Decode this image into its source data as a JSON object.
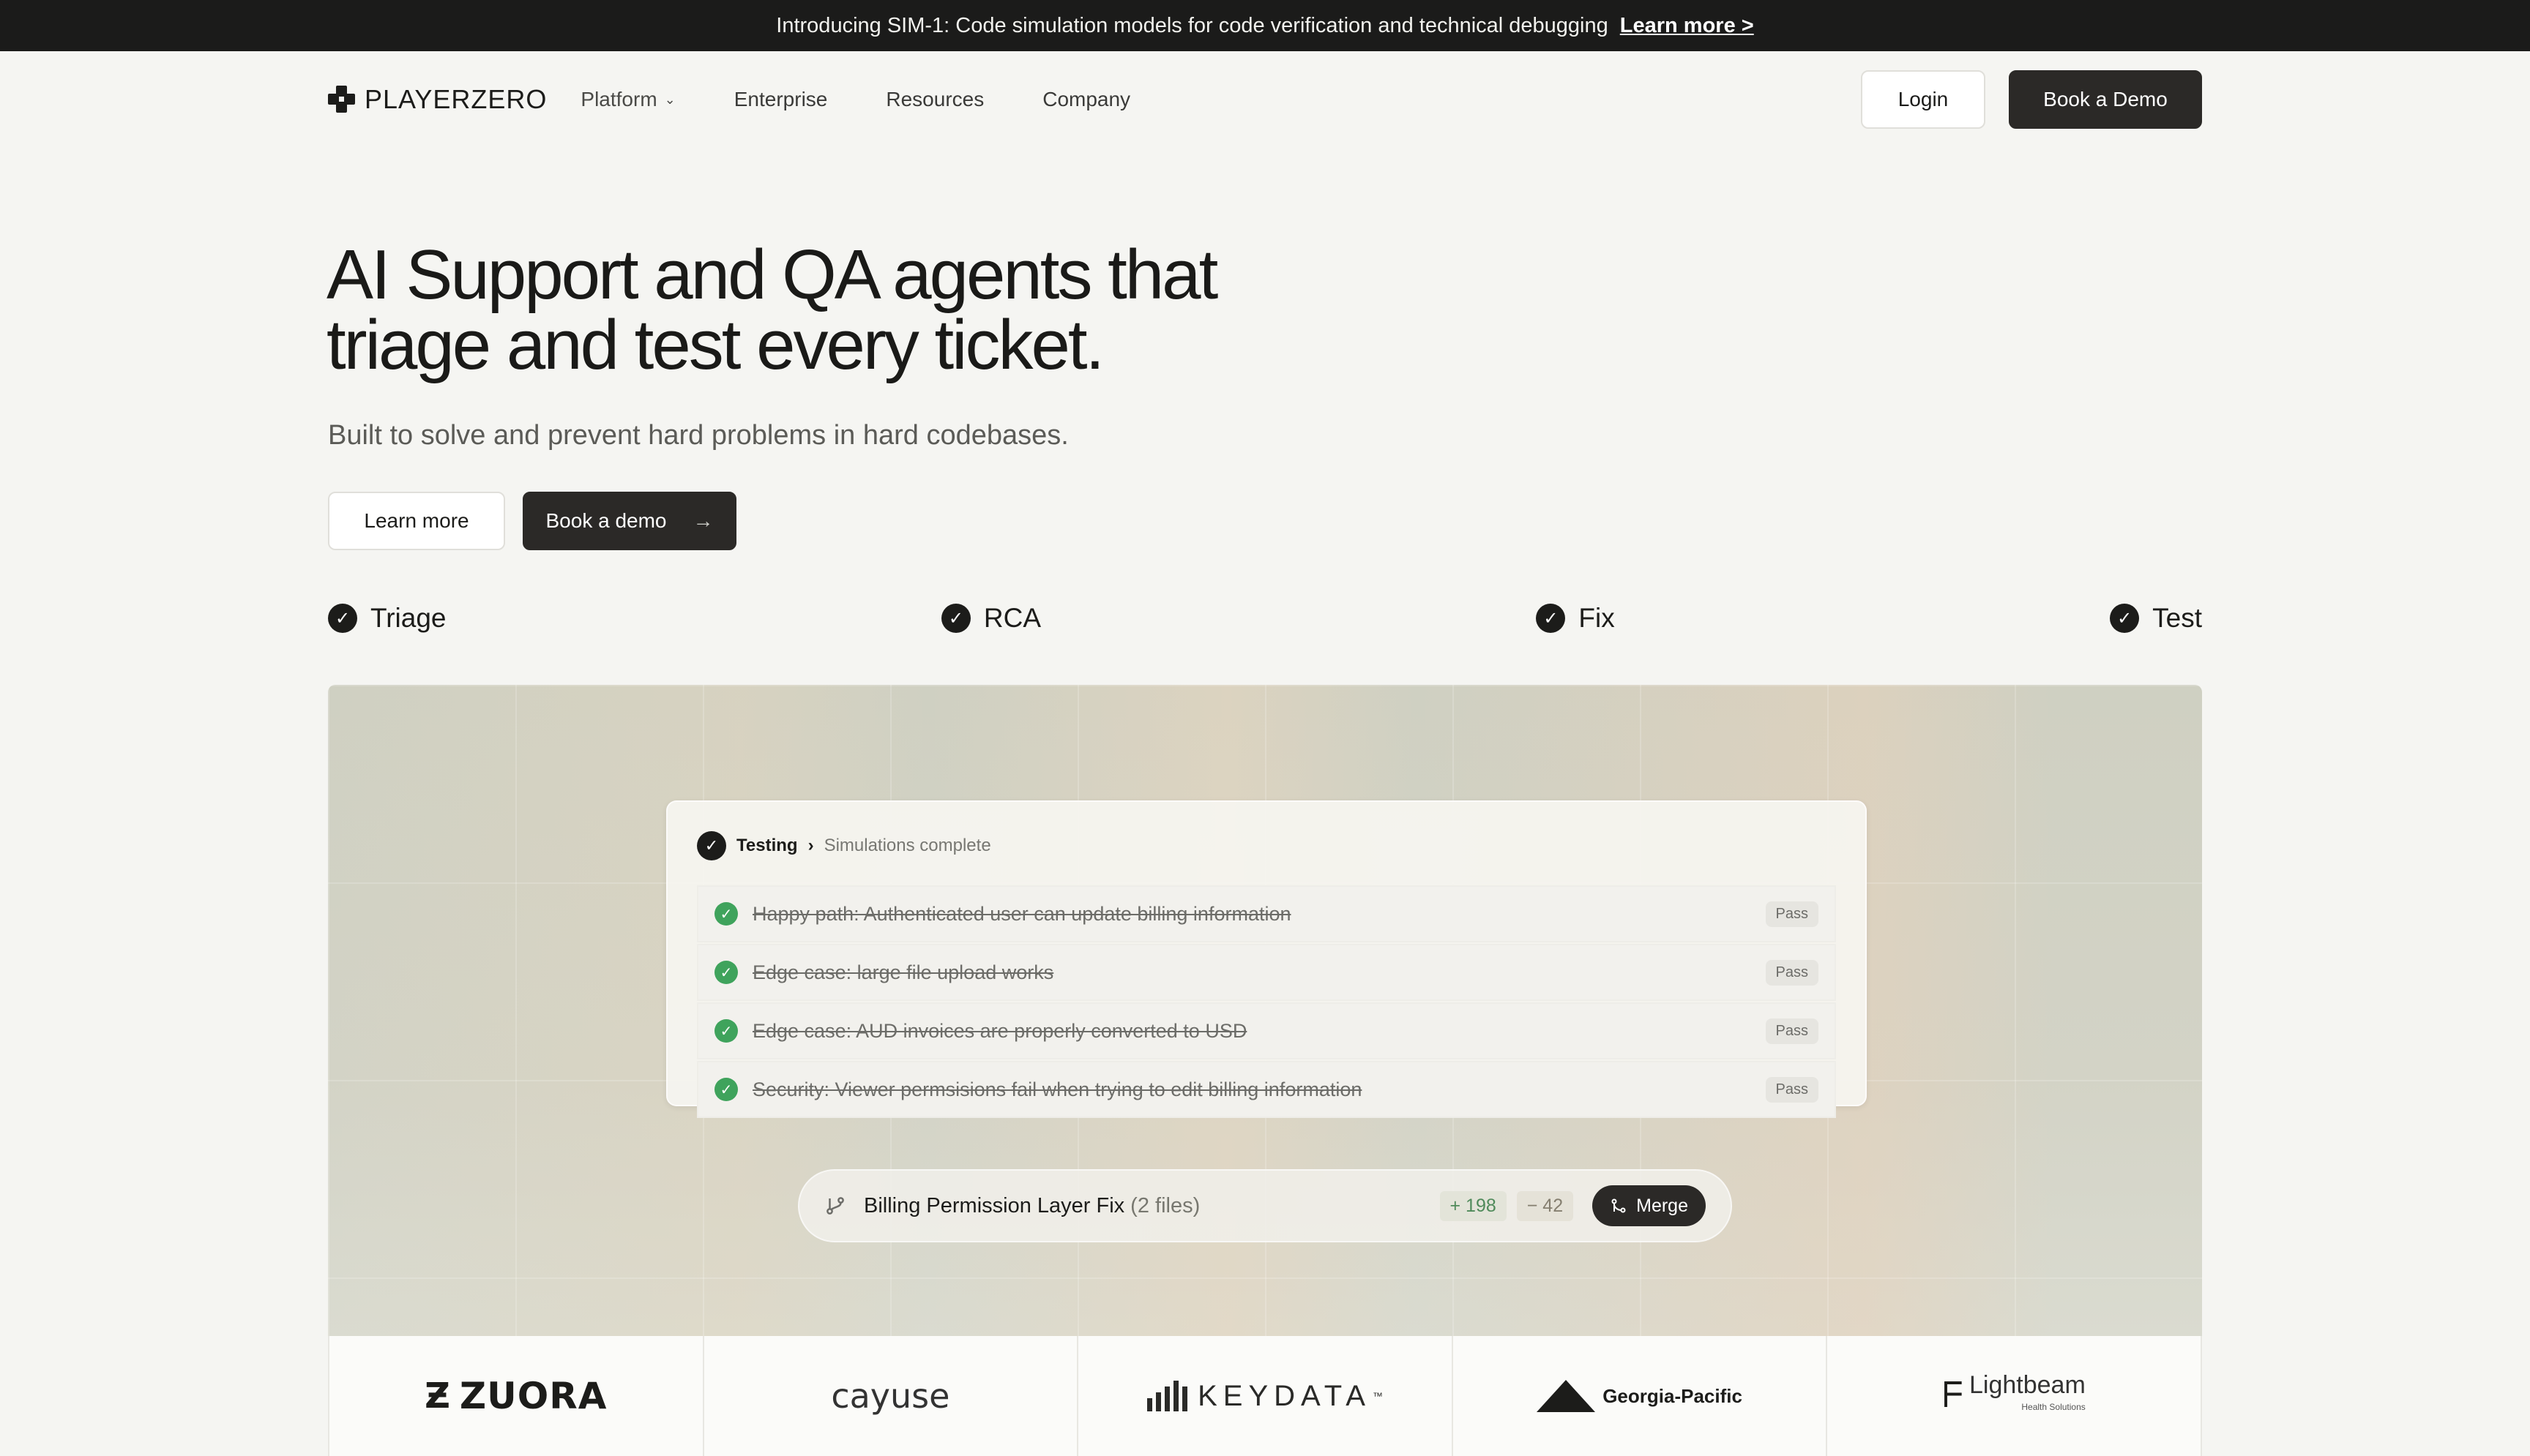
{
  "announcement": {
    "text": "Introducing SIM-1: Code simulation models for code verification and technical debugging",
    "link": "Learn more >"
  },
  "nav": {
    "logo_text": "PLAYERZERO",
    "links": [
      "Platform",
      "Enterprise",
      "Resources",
      "Company"
    ],
    "login": "Login",
    "book_demo": "Book a Demo"
  },
  "hero": {
    "title_line1": "AI Support and QA agents that",
    "title_line2": "triage and test every ticket.",
    "subtitle": "Built to solve and prevent hard problems in hard codebases.",
    "cta_secondary": "Learn more",
    "cta_primary": "Book a demo"
  },
  "steps": [
    "Triage",
    "RCA",
    "Fix",
    "Test"
  ],
  "testing_card": {
    "label": "Testing",
    "separator": "›",
    "status": "Simulations complete",
    "rows": [
      {
        "text": "Happy path: Authenticated user can update billing information",
        "badge": "Pass"
      },
      {
        "text": "Edge case: large file upload works",
        "badge": "Pass"
      },
      {
        "text": "Edge case: AUD invoices are properly converted to USD",
        "badge": "Pass"
      },
      {
        "text": "Security: Viewer permsisions fail when trying to edit billing information",
        "badge": "Pass"
      }
    ]
  },
  "pr": {
    "title": "Billing Permission Layer Fix",
    "files": "(2 files)",
    "additions": "+ 198",
    "deletions": "− 42",
    "merge": "Merge"
  },
  "customer_logos": {
    "zuora": "ZUORA",
    "cayuse": "cayuse",
    "keydata": "KEYDATA",
    "keydata_tm": "™",
    "georgia_pacific": "Georgia-Pacific",
    "lightbeam": "Lightbeam",
    "lightbeam_sub": "Health Solutions"
  },
  "colors": {
    "dark": "#2b2927",
    "announcement_bg": "#1b1b1a",
    "pass_green": "#3fa35c",
    "background": "#f5f5f2"
  }
}
